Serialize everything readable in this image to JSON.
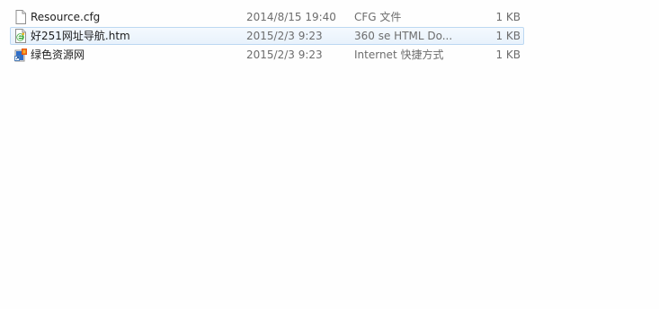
{
  "files": [
    {
      "name": "Resource.cfg",
      "modified": "2014/8/15 19:40",
      "type": "CFG 文件",
      "size": "1 KB",
      "icon": "blank-file-icon",
      "selected": false
    },
    {
      "name": "好251网址导航.htm",
      "modified": "2015/2/3 9:23",
      "type": "360 se HTML Do...",
      "size": "1 KB",
      "icon": "360se-html-file-icon",
      "selected": true
    },
    {
      "name": "绿色资源网",
      "modified": "2015/2/3 9:23",
      "type": "Internet 快捷方式",
      "size": "1 KB",
      "icon": "internet-shortcut-icon",
      "selected": false
    }
  ],
  "colors": {
    "selection_fill": "#e8f2fc",
    "selection_border": "#bcd8f2",
    "name_text": "#1e1e1e",
    "detail_text": "#6d6d6d"
  }
}
